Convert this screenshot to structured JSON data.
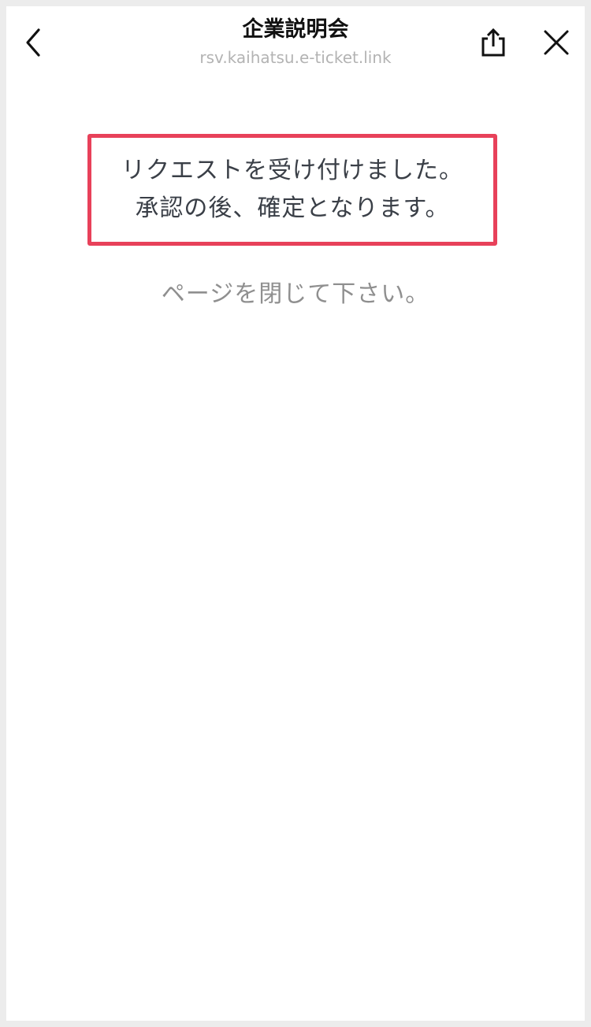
{
  "header": {
    "title": "企業説明会",
    "url": "rsv.kaihatsu.e-ticket.link",
    "icons": {
      "back": "chevron-left-icon",
      "share": "share-icon",
      "close": "close-icon"
    }
  },
  "content": {
    "notice_lines": [
      "リクエストを受け付けました。",
      "承認の後、確定となります。"
    ],
    "close_message": "ページを閉じて下さい。"
  },
  "colors": {
    "highlight_border": "#e8415a",
    "body_text": "#3a3f47",
    "muted_text": "#8f8f8f",
    "url_text": "#b3b3b3"
  }
}
